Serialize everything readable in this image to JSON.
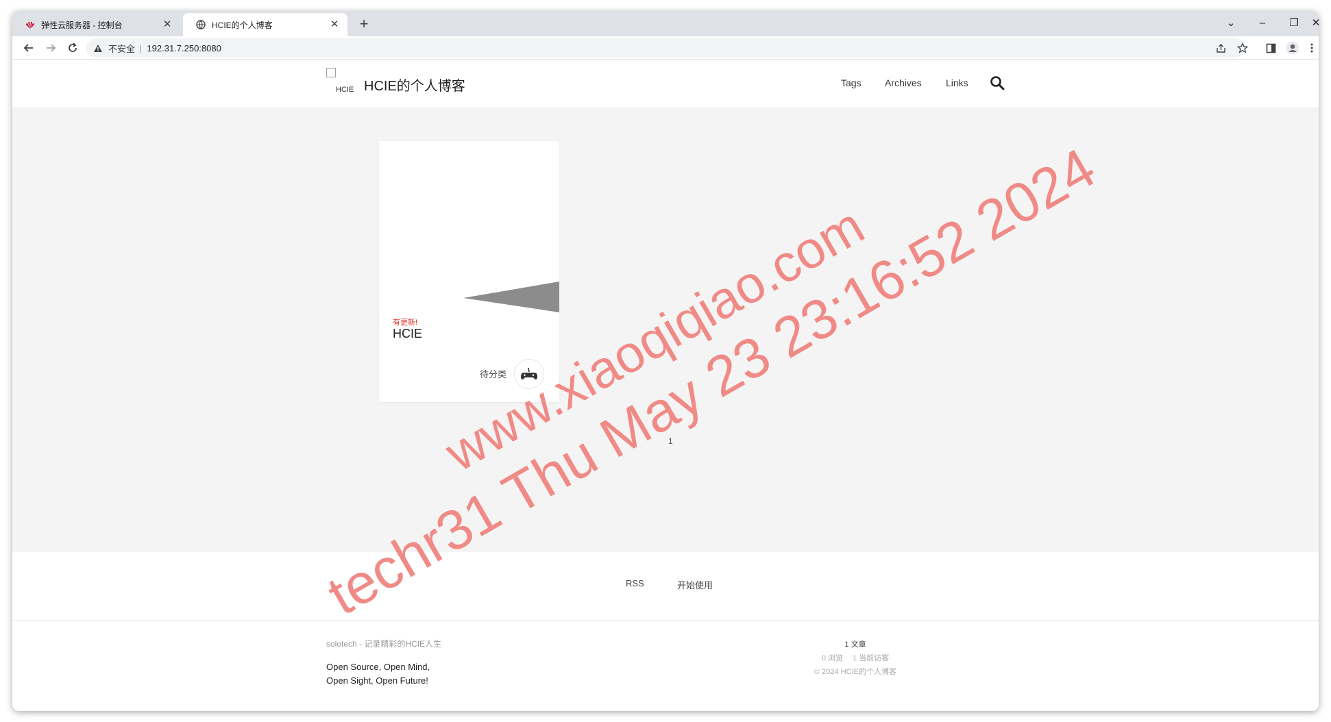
{
  "browser": {
    "tabs": [
      {
        "title": "弹性云服务器 - 控制台",
        "favicon": "huawei-icon",
        "active": false
      },
      {
        "title": "HCIE的个人博客",
        "favicon": "globe-icon",
        "active": true
      }
    ],
    "address": {
      "security_label": "不安全",
      "separator": "|",
      "url": "192.31.7.250:8080"
    }
  },
  "site": {
    "logo_alt": "HCIE",
    "title": "HCIE的个人博客",
    "nav": [
      "Tags",
      "Archives",
      "Links"
    ]
  },
  "article": {
    "badge": "有更新!",
    "title": "HCIE",
    "category": "待分类",
    "avatar_icon": "gamepad-icon"
  },
  "pagination": {
    "current": "1"
  },
  "footer": {
    "links": [
      "RSS",
      "开始使用"
    ],
    "tagline": "solotech - 记录精彩的HCIE人生",
    "motto": [
      "Open Source, Open Mind,",
      "Open Sight, Open Future!"
    ],
    "stats": {
      "articles": "1 文章",
      "views": "0 浏览",
      "visitors": "1 当前访客",
      "copyright": "© 2024 HCIE的个人博客"
    }
  },
  "watermark": {
    "line1": "www.xiaoqiqiao.com",
    "line2": "techr31 Thu May 23 23:16:52 2024",
    "color": "#f08a86"
  }
}
